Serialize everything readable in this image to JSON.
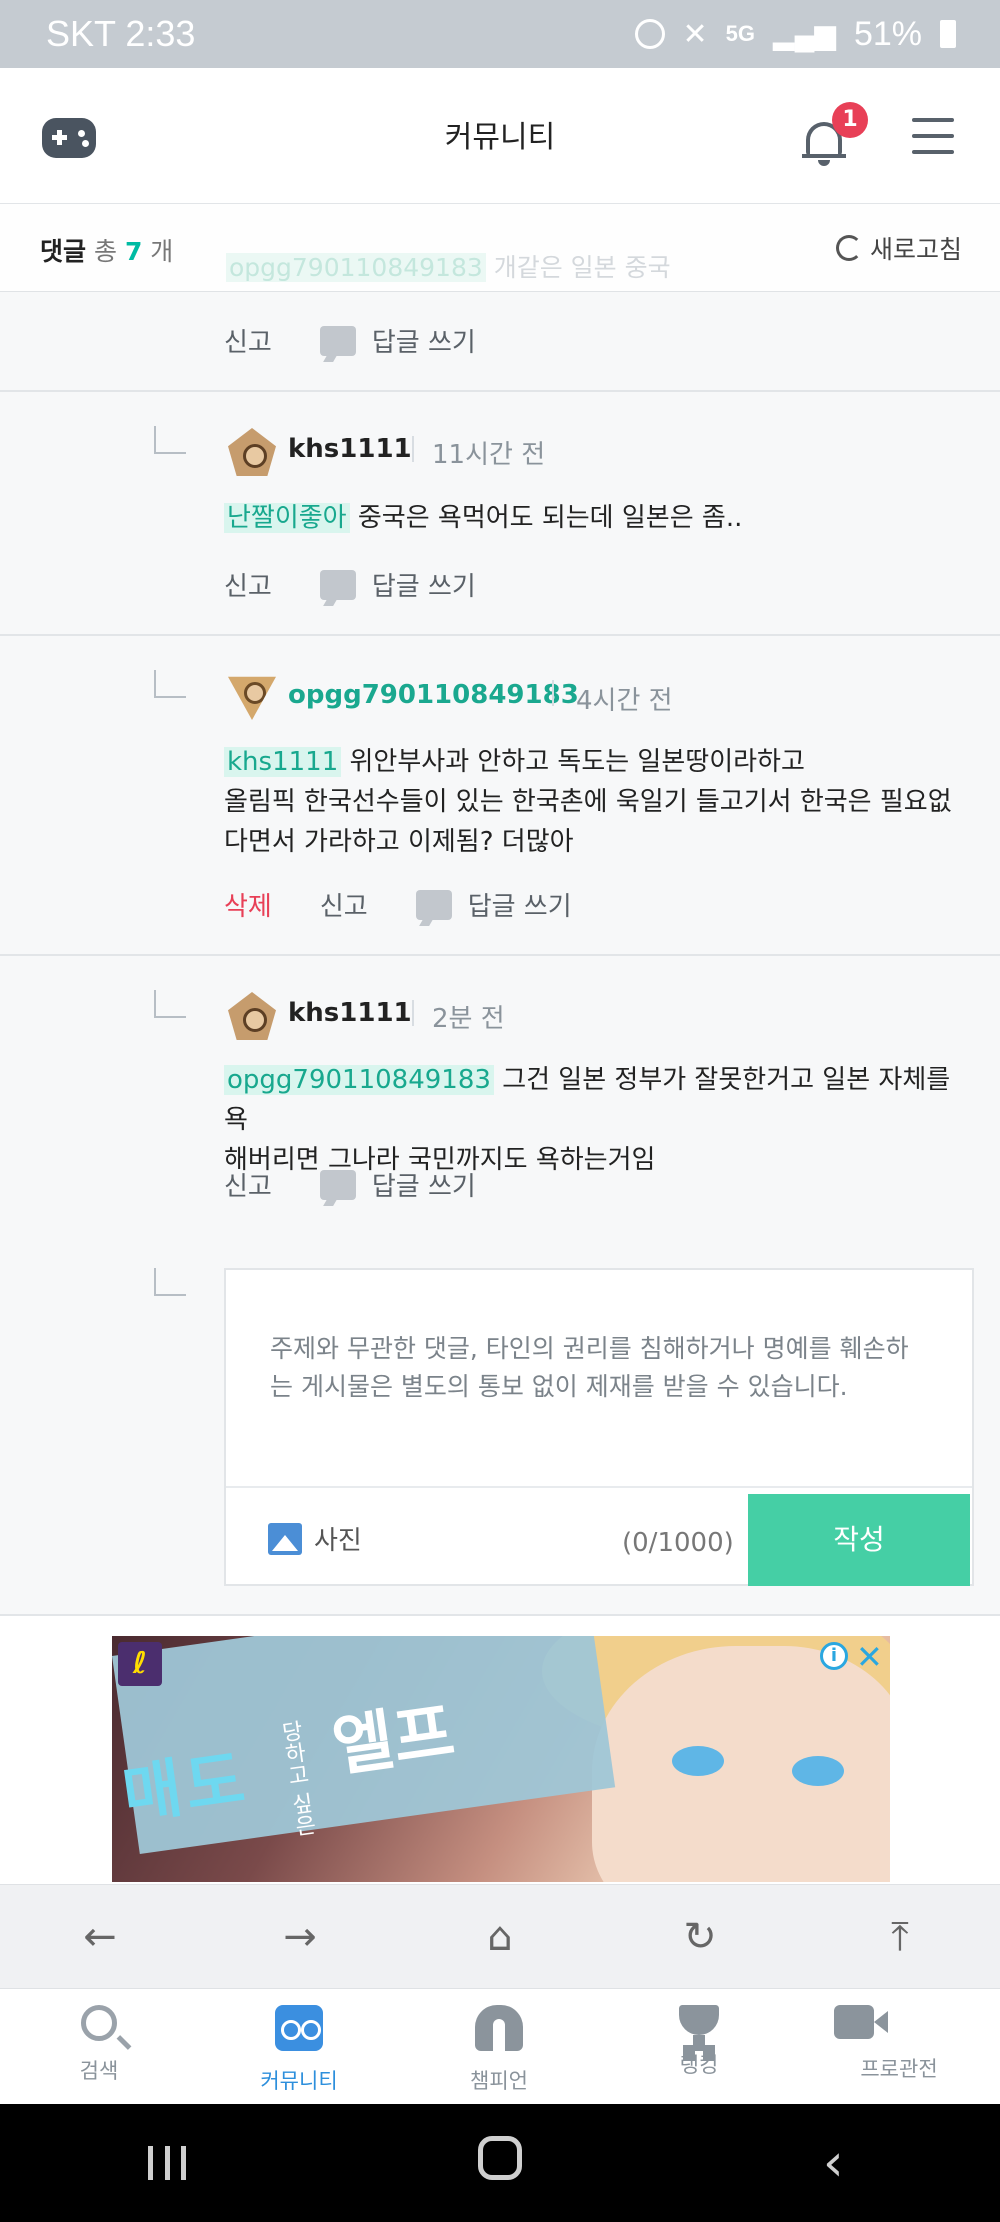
{
  "status_bar": {
    "carrier_time": "SKT 2:33",
    "battery": "51%",
    "icons": [
      "alarm-icon",
      "mute-icon",
      "5g-icon",
      "signal-icon",
      "battery-icon"
    ]
  },
  "header": {
    "title": "커뮤니티",
    "notification_count": "1"
  },
  "comments_bar": {
    "label": "댓글",
    "total_prefix": "총",
    "count": "7",
    "unit": "개",
    "refresh": "새로고침"
  },
  "faded_comment": {
    "mention": "opgg790110849183",
    "text": "개같은 일본 중국"
  },
  "comments": [
    {
      "actions": {
        "report": "신고",
        "reply": "답글 쓰기"
      }
    },
    {
      "user": "khs1111",
      "time": "11시간 전",
      "mention": "난짤이좋아",
      "text": "중국은 욕먹어도 되는데 일본은 좀..",
      "actions": {
        "report": "신고",
        "reply": "답글 쓰기"
      }
    },
    {
      "user": "opgg790110849183",
      "time": "4시간 전",
      "mention": "khs1111",
      "text": "위안부사과 안하고 독도는 일본땅이라하고",
      "text_line2": "올림픽 한국선수들이 있는 한국촌에 욱일기 들고기서 한국은 필요없",
      "text_line3": "다면서 가라하고 이제됨? 더많아",
      "actions": {
        "delete": "삭제",
        "report": "신고",
        "reply": "답글 쓰기"
      }
    },
    {
      "user": "khs1111",
      "time": "2분 전",
      "mention": "opgg790110849183",
      "text": "그건 일본 정부가 잘못한거고 일본 자체를 욕",
      "text_line2": "해버리면 그나라 국민까지도 욕하는거임",
      "actions": {
        "report": "신고",
        "reply": "답글 쓰기"
      }
    }
  ],
  "editor": {
    "placeholder_line1": "주제와 무관한 댓글, 타인의 권리를 침해하거나 명예를 훼손하",
    "placeholder_line2": "는 게시물은 별도의 통보 없이 제재를 받을 수 있습니다.",
    "photo": "사진",
    "count": "(0/1000)",
    "submit": "작성"
  },
  "ad": {
    "text_main": "매도",
    "text_sub": "당하고 싶은",
    "text_title": "엘프"
  },
  "browser_toolbar": [
    "back-icon",
    "forward-icon",
    "home-icon",
    "reload-icon",
    "scroll-top-icon"
  ],
  "bottom_nav": [
    {
      "label": "검색",
      "icon": "search-icon",
      "active": false
    },
    {
      "label": "커뮤니티",
      "icon": "community-icon",
      "active": true
    },
    {
      "label": "챔피언",
      "icon": "champion-icon",
      "active": false
    },
    {
      "label": "랭킹",
      "icon": "trophy-icon",
      "active": false
    },
    {
      "label": "프로관전",
      "icon": "video-icon",
      "active": false
    }
  ],
  "colors": {
    "accent": "#45cfa5",
    "mention_bg": "#d9f5ee",
    "mention_text": "#18a88e",
    "delete": "#e84057",
    "nav_active": "#2d8fdc"
  }
}
